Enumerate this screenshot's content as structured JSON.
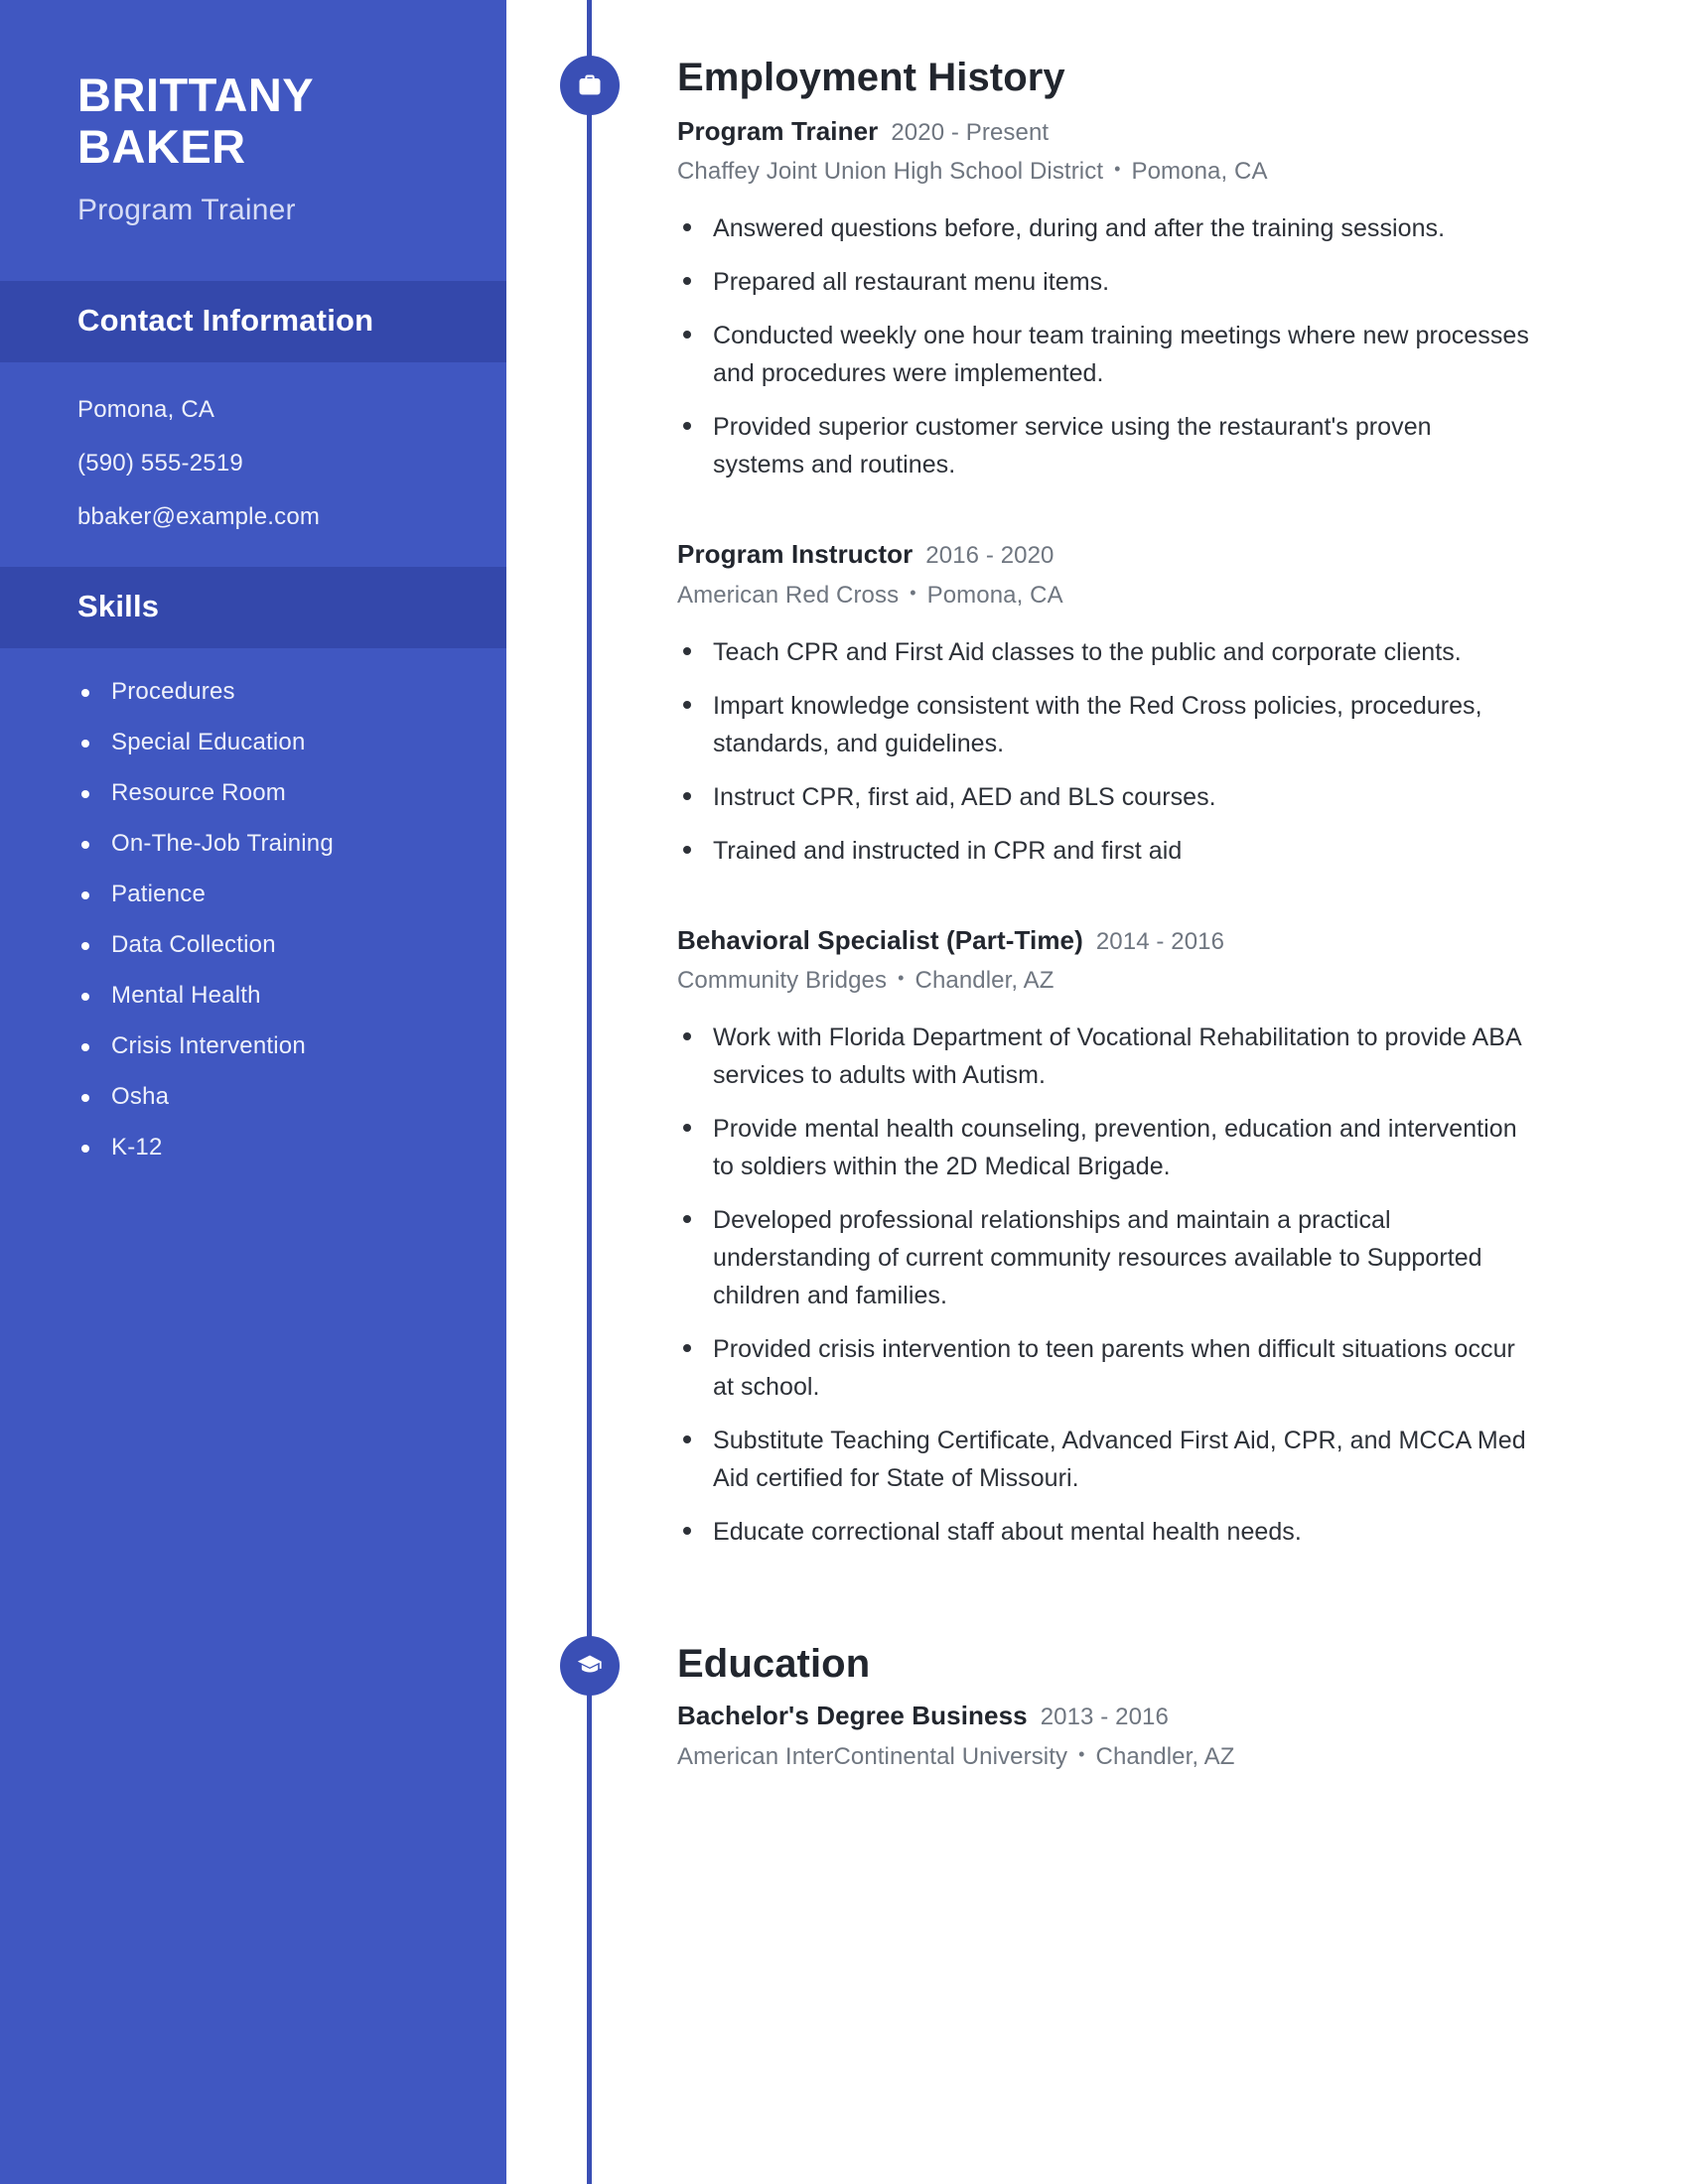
{
  "colors": {
    "sidebar_bg": "#4057c1",
    "sidebar_band_bg": "#3448ab",
    "accent": "#3a4fb5",
    "body_text": "#2d3138",
    "muted_text": "#6f7680"
  },
  "sidebar": {
    "name": "BRITTANY\nBAKER",
    "job_title": "Program Trainer",
    "contact": {
      "heading": "Contact Information",
      "lines": [
        "Pomona, CA",
        "(590) 555-2519",
        "bbaker@example.com"
      ]
    },
    "skills": {
      "heading": "Skills",
      "items": [
        "Procedures",
        "Special Education",
        "Resource Room",
        "On-The-Job Training",
        "Patience",
        "Data Collection",
        "Mental Health",
        "Crisis Intervention",
        "Osha",
        "K-12"
      ]
    }
  },
  "main": {
    "employment": {
      "icon": "briefcase-icon",
      "heading": "Employment History",
      "entries": [
        {
          "role": "Program Trainer",
          "dates": "2020 - Present",
          "company": "Chaffey Joint Union High School District",
          "location": "Pomona, CA",
          "bullets": [
            "Answered questions before, during and after the training sessions.",
            "Prepared all restaurant menu items.",
            "Conducted weekly one hour team training meetings where new processes and procedures were implemented.",
            "Provided superior customer service using the restaurant's proven systems and routines."
          ]
        },
        {
          "role": "Program Instructor",
          "dates": "2016 - 2020",
          "company": "American Red Cross",
          "location": "Pomona, CA",
          "bullets": [
            "Teach CPR and First Aid classes to the public and corporate clients.",
            "Impart knowledge consistent with the Red Cross policies, procedures, standards, and guidelines.",
            "Instruct CPR, first aid, AED and BLS courses.",
            "Trained and instructed in CPR and first aid"
          ]
        },
        {
          "role": "Behavioral Specialist (Part-Time)",
          "dates": "2014 - 2016",
          "company": "Community Bridges",
          "location": "Chandler, AZ",
          "bullets": [
            "Work with Florida Department of Vocational Rehabilitation to provide ABA services to adults with Autism.",
            "Provide mental health counseling, prevention, education and intervention to soldiers within the 2D Medical Brigade.",
            "Developed professional relationships and maintain a practical understanding of current community resources available to Supported children and families.",
            "Provided crisis intervention to teen parents when difficult situations occur at school.",
            "Substitute Teaching Certificate, Advanced First Aid, CPR, and MCCA Med Aid certified for State of Missouri.",
            "Educate correctional staff about mental health needs."
          ]
        }
      ]
    },
    "education": {
      "icon": "graduation-cap-icon",
      "heading": "Education",
      "entries": [
        {
          "degree": "Bachelor's Degree Business",
          "dates": "2013 - 2016",
          "school": "American InterContinental University",
          "location": "Chandler, AZ"
        }
      ]
    },
    "separator": "•"
  }
}
